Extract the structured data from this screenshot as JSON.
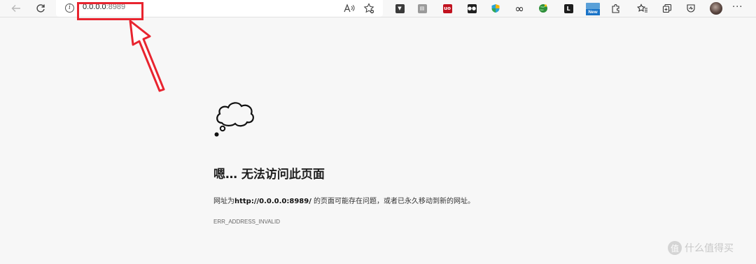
{
  "toolbar": {
    "back_icon": "arrow-left-icon",
    "reload_icon": "reload-icon"
  },
  "addressbar": {
    "url_host": "0.0.0.0",
    "url_port": ":8989",
    "info_glyph": "i"
  },
  "extensions": [
    {
      "name": "shield-extension-icon",
      "color": "#3a3a3a",
      "glyph": "▼"
    },
    {
      "name": "reader-extension-icon",
      "color": "#8a8a8a",
      "glyph": "▤"
    },
    {
      "name": "ublock-extension-icon",
      "color": "#c1121f",
      "glyph": "uo"
    },
    {
      "name": "tampermonkey-extension-icon",
      "color": "#202020",
      "glyph": "●●"
    },
    {
      "name": "colorful-shield-extension-icon",
      "color": "#2aa4d6",
      "glyph": "◆"
    },
    {
      "name": "infinity-extension-icon",
      "color": "#f7f7f7",
      "glyph": "∞"
    },
    {
      "name": "globe-extension-icon",
      "color": "#2f8f3a",
      "glyph": "◉"
    },
    {
      "name": "l-extension-icon",
      "color": "#1d1d1d",
      "glyph": "L"
    }
  ],
  "new_badge": "New",
  "more_glyph": "···",
  "page": {
    "title": "嗯… 无法访问此页面",
    "desc_prefix": "网址为",
    "desc_url": "http://0.0.0.0:8989/",
    "desc_suffix": " 的页面可能存在问题，或者已永久移动到新的网址。",
    "error_code": "ERR_ADDRESS_INVALID"
  },
  "watermark": {
    "logo_glyph": "值",
    "text": "什么值得买"
  },
  "colors": {
    "highlight": "#e8242f",
    "background": "#f7f7f7"
  }
}
